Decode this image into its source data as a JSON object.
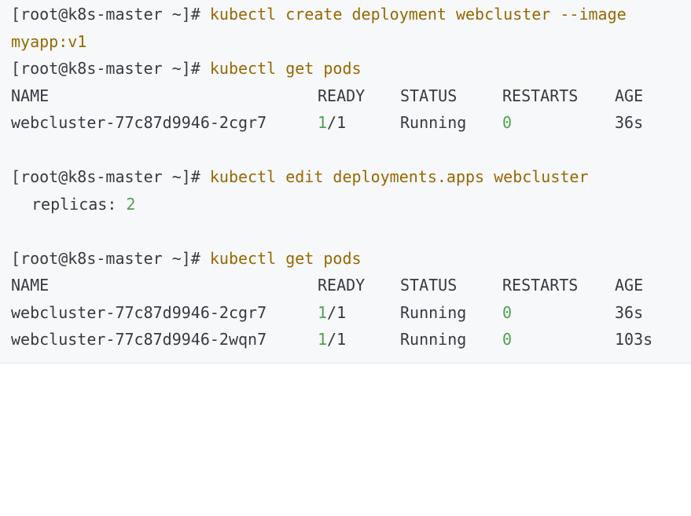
{
  "colors": {
    "background": "#f6f8fa",
    "text": "#383a42",
    "command": "#986801",
    "number": "#50a14f"
  },
  "prompt": "[root@k8s-master ~]#",
  "commands": {
    "create": "kubectl create deployment webcluster --image",
    "create_cont": "myapp:v1",
    "get_pods": "kubectl get pods",
    "edit": "kubectl edit deployments.apps webcluster"
  },
  "replicas": {
    "label": "replicas:",
    "value": "2"
  },
  "headers": {
    "name": "NAME",
    "ready": "READY",
    "status": "STATUS",
    "restarts": "RESTARTS",
    "age": "AGE"
  },
  "pods_first": [
    {
      "name": "webcluster-77c87d9946-2cgr7",
      "ready_num": "1",
      "ready_rest": "/1",
      "status": "Running",
      "restarts": "0",
      "age": "36s"
    }
  ],
  "pods_second": [
    {
      "name": "webcluster-77c87d9946-2cgr7",
      "ready_num": "1",
      "ready_rest": "/1",
      "status": "Running",
      "restarts": "0",
      "age": "36s"
    },
    {
      "name": "webcluster-77c87d9946-2wqn7",
      "ready_num": "1",
      "ready_rest": "/1",
      "status": "Running",
      "restarts": "0",
      "age": "103s"
    }
  ]
}
